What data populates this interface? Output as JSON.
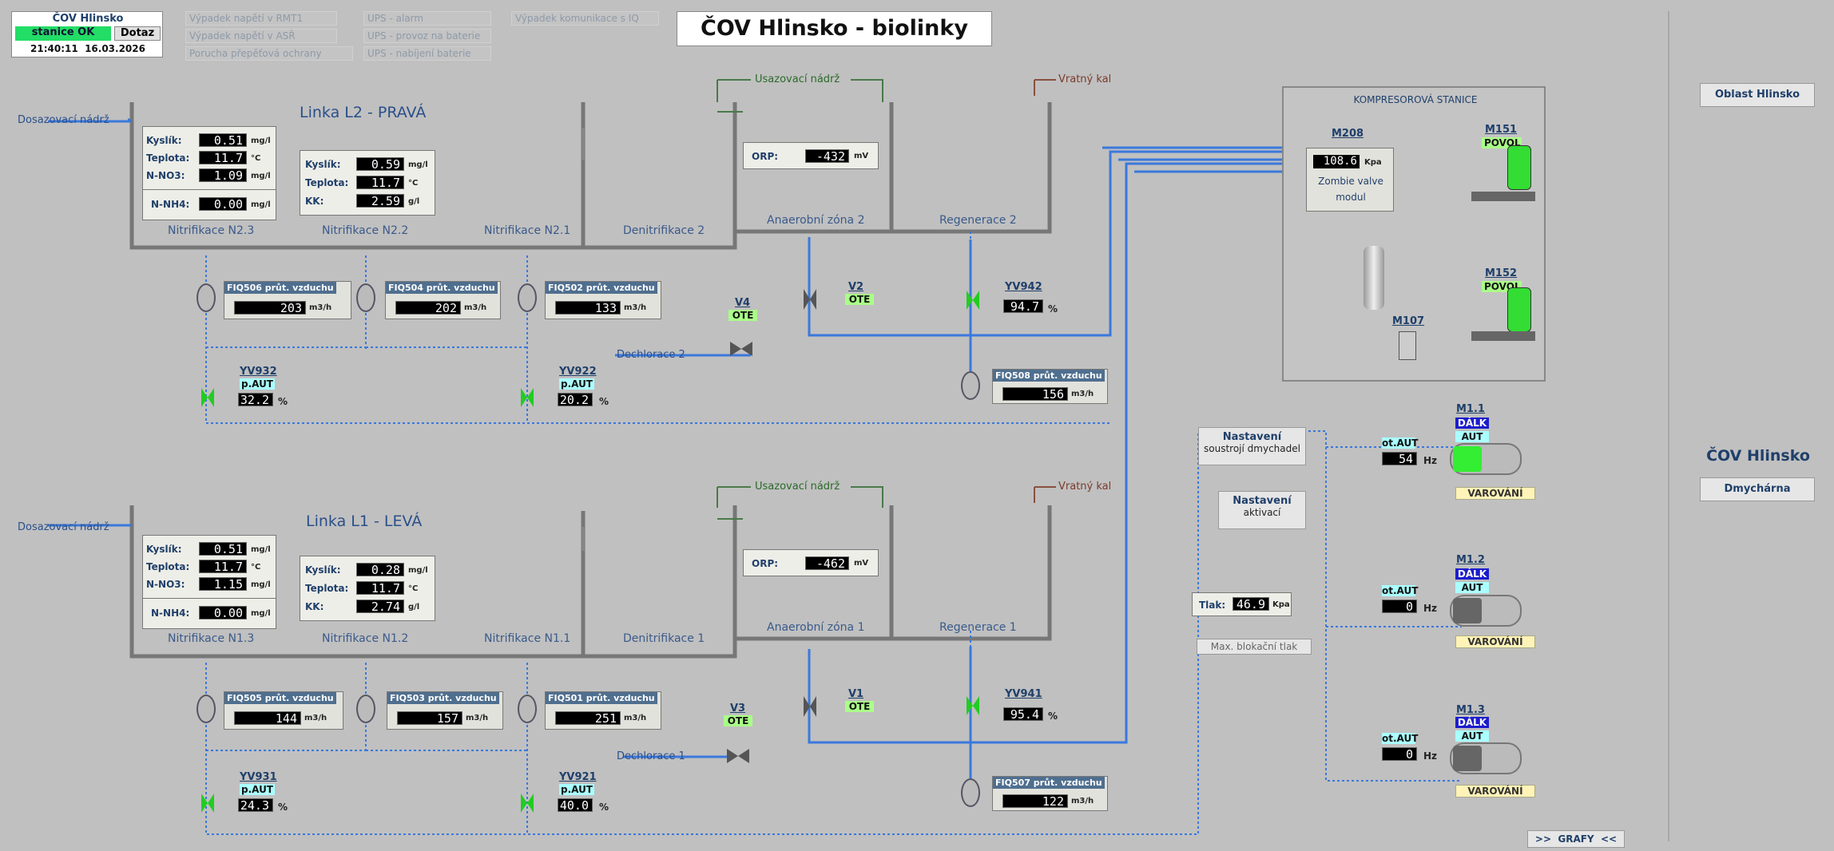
{
  "status": {
    "site": "ČOV Hlinsko",
    "station": "stanice OK",
    "query": "Dotaz",
    "datetime": "21:40:11  16.03.2026"
  },
  "alarms": [
    "Výpadek napětí v RMT1",
    "Výpadek napětí v ASŘ",
    "Porucha přepěťová ochrany",
    "UPS - alarm",
    "UPS - provoz na baterie",
    "UPS - nabíjení baterie",
    "Výpadek komunikace s IQ"
  ],
  "title": "ČOV Hlinsko - biolinky",
  "l2": {
    "name": "Linka L2 - PRAVÁ",
    "dosaz": "Dosazovací nádrž",
    "usaz": "Usazovací nádrž",
    "vratny": "Vratný kal",
    "p1": {
      "kyslik": "0.51",
      "teplota": "11.7",
      "nno3": "1.09",
      "nnh4": "0.00"
    },
    "p2": {
      "kyslik": "0.59",
      "teplota": "11.7",
      "kk": "2.59"
    },
    "orp": "-432",
    "zones": [
      "Nitrifikace N2.3",
      "Nitrifikace N2.2",
      "Nitrifikace N2.1",
      "Denitrifikace 2",
      "Anaerobní zóna 2",
      "Regenerace 2"
    ],
    "fiq506": "203",
    "fiq504": "202",
    "fiq502": "133",
    "fiq508": "156",
    "yv932": "32.2",
    "yv922": "20.2",
    "yv942": "94.7",
    "dechlor": "Dechlorace 2"
  },
  "l1": {
    "name": "Linka L1 - LEVÁ",
    "dosaz": "Dosazovací nádrž",
    "usaz": "Usazovací nádrž",
    "vratny": "Vratný kal",
    "p1": {
      "kyslik": "0.51",
      "teplota": "11.7",
      "nno3": "1.15",
      "nnh4": "0.00"
    },
    "p2": {
      "kyslik": "0.28",
      "teplota": "11.7",
      "kk": "2.74"
    },
    "orp": "-462",
    "zones": [
      "Nitrifikace N1.3",
      "Nitrifikace N1.2",
      "Nitrifikace N1.1",
      "Denitrifikace 1",
      "Anaerobní zóna 1",
      "Regenerace 1"
    ],
    "fiq505": "144",
    "fiq503": "157",
    "fiq501": "251",
    "fiq507": "122",
    "yv931": "24.3",
    "yv921": "40.0",
    "yv941": "95.4",
    "dechlor": "Dechlorace 1"
  },
  "labels": {
    "kyslik": "Kyslík:",
    "teplota": "Teplota:",
    "nno3": "N-NO3:",
    "nnh4": "N-NH4:",
    "kk": "KK:",
    "orp": "ORP:",
    "mgl": "mg/l",
    "degc": "°C",
    "gl": "g/l",
    "mv": "mV",
    "m3h": "m3/h",
    "pct": "%",
    "kpa": "Kpa",
    "hz": "Hz",
    "ote": "OTE",
    "paut": "p.AUT",
    "otaut": "ot.AUT",
    "dalk": "DÁLK",
    "aut": "AUT",
    "varovani": "VAROVÁNÍ",
    "povol": "POVOL"
  },
  "fiq": {
    "f506": "FIQ506 průt. vzduchu",
    "f504": "FIQ504 průt. vzduchu",
    "f502": "FIQ502 průt. vzduchu",
    "f508": "FIQ508 průt. vzduchu",
    "f505": "FIQ505 průt. vzduchu",
    "f503": "FIQ503 průt. vzduchu",
    "f501": "FIQ501 průt. vzduchu",
    "f507": "FIQ507 průt. vzduchu"
  },
  "valves": {
    "v4": "V4",
    "v2": "V2",
    "v3": "V3",
    "v1": "V1",
    "yv942": "YV942",
    "yv932": "YV932",
    "yv922": "YV922",
    "yv941": "YV941",
    "yv931": "YV931",
    "yv921": "YV921"
  },
  "compressor": {
    "title": "KOMPRESOROVÁ STANICE",
    "m208": "M208",
    "pressure": "108.6",
    "zombie": "Zombie valve",
    "modul": "modul",
    "m151": "M151",
    "m152": "M152",
    "m107": "M107"
  },
  "blowers": {
    "b1": {
      "name": "M1.1",
      "hz": "54"
    },
    "b2": {
      "name": "M1.2",
      "hz": "0"
    },
    "b3": {
      "name": "M1.3",
      "hz": "0"
    }
  },
  "settings": {
    "s1a": "Nastavení",
    "s1b": "soustrojí dmychadel",
    "s2a": "Nastavení",
    "s2b": "aktivací",
    "tlak_lbl": "Tlak:",
    "tlak": "46.9",
    "maxblok": "Max. blokační tlak"
  },
  "nav": {
    "oblast": "Oblast Hlinsko",
    "cov": "ČOV Hlinsko",
    "dmych": "Dmychárna",
    "grafy": ">>  GRAFY  <<"
  }
}
